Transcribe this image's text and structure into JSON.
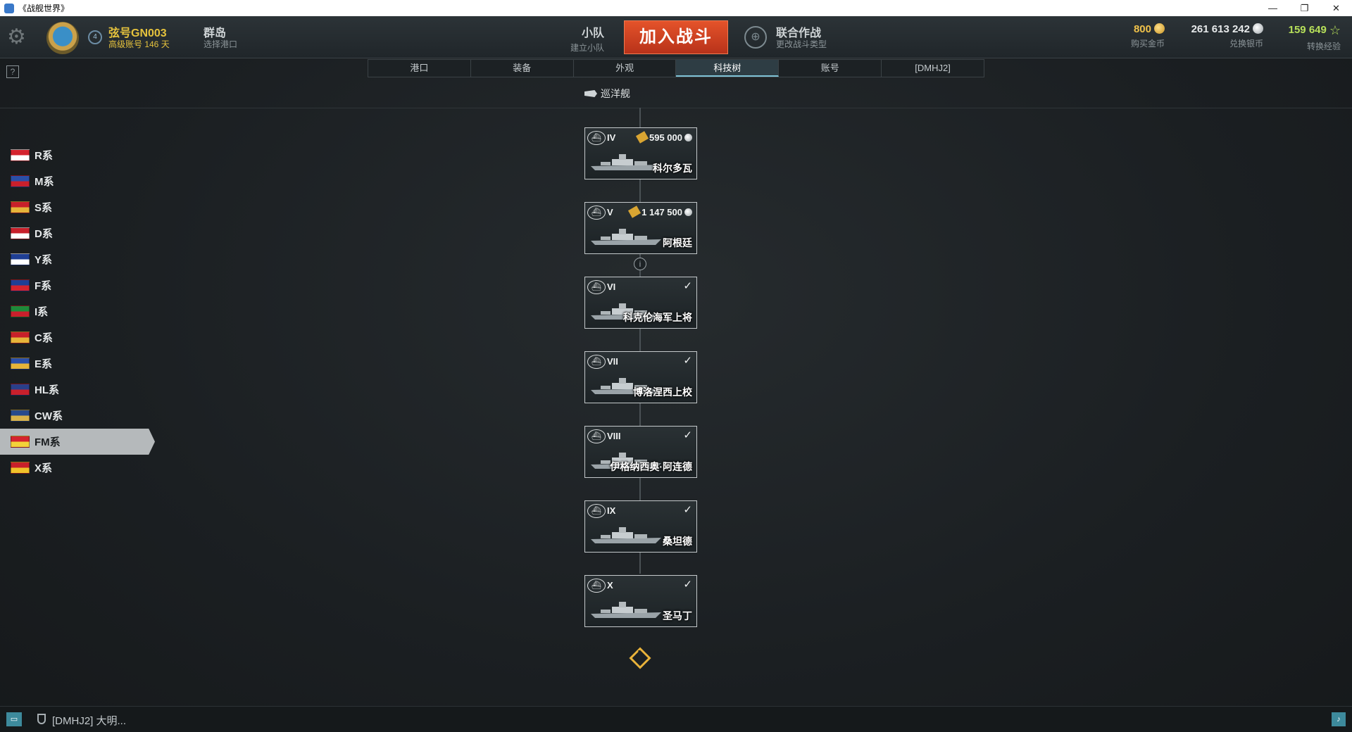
{
  "window": {
    "title": "《战舰世界》",
    "controls": [
      "—",
      "❐",
      "✕"
    ]
  },
  "header": {
    "player_name": "弦号GN003",
    "player_sub": "高级账号 146 天",
    "rank_badge": "4",
    "port_name": "群岛",
    "port_sub": "选择港口",
    "squad_title": "小队",
    "squad_sub": "建立小队",
    "battle_button": "加入战斗",
    "mode_title": "联合作战",
    "mode_sub": "更改战斗类型",
    "gold_value": "800",
    "gold_label": "购买金币",
    "silver_value": "261 613 242",
    "silver_label": "兑换银币",
    "xp_value": "159 649",
    "xp_label": "转换经验"
  },
  "tabs": [
    {
      "label": "港口",
      "active": false
    },
    {
      "label": "装备",
      "active": false
    },
    {
      "label": "外观",
      "active": false
    },
    {
      "label": "科技树",
      "active": true
    },
    {
      "label": "账号",
      "active": false
    },
    {
      "label": "[DMHJ2]",
      "active": false
    }
  ],
  "help_label": "?",
  "ship_class": "巡洋舰",
  "nations": [
    {
      "label": "R系",
      "colors": [
        "#d4232e",
        "#ffffff"
      ]
    },
    {
      "label": "M系",
      "colors": [
        "#2a4fa8",
        "#c9202c"
      ]
    },
    {
      "label": "S系",
      "colors": [
        "#c8202a",
        "#e6b43a"
      ]
    },
    {
      "label": "D系",
      "colors": [
        "#c8202a",
        "#ffffff"
      ]
    },
    {
      "label": "Y系",
      "colors": [
        "#1f3f95",
        "#ffffff"
      ]
    },
    {
      "label": "F系",
      "colors": [
        "#1f3f95",
        "#d4232e"
      ]
    },
    {
      "label": "I系",
      "colors": [
        "#1e8a3a",
        "#c9202c"
      ]
    },
    {
      "label": "C系",
      "colors": [
        "#c8202a",
        "#e6b43a"
      ]
    },
    {
      "label": "E系",
      "colors": [
        "#2a4fa8",
        "#e6b43a"
      ]
    },
    {
      "label": "HL系",
      "colors": [
        "#2a3f8a",
        "#c9202c"
      ]
    },
    {
      "label": "CW系",
      "colors": [
        "#274a8c",
        "#d8b24a"
      ]
    },
    {
      "label": "FM系",
      "colors": [
        "#d4232e",
        "#f3d23a"
      ],
      "active": true
    },
    {
      "label": "X系",
      "colors": [
        "#c8202a",
        "#f0c22a"
      ]
    }
  ],
  "ships": [
    {
      "tier": "IV",
      "name": "科尔多瓦",
      "price": "595 000",
      "researched": false
    },
    {
      "tier": "V",
      "name": "阿根廷",
      "price": "1 147 500",
      "researched": false
    },
    {
      "tier": "VI",
      "name": "科克伦海军上将",
      "price": "",
      "researched": true
    },
    {
      "tier": "VII",
      "name": "博洛涅西上校",
      "price": "",
      "researched": true
    },
    {
      "tier": "VIII",
      "name": "伊格纳西奥·阿连德",
      "price": "",
      "researched": true
    },
    {
      "tier": "IX",
      "name": "桑坦德",
      "price": "",
      "researched": true
    },
    {
      "tier": "X",
      "name": "圣马丁",
      "price": "",
      "researched": true
    }
  ],
  "info_label": "i",
  "bottom": {
    "clan_text": "[DMHJ2] 大明..."
  },
  "colors": {
    "accent": "#d9452a",
    "gold": "#e5c23d",
    "xp": "#b7e05a"
  }
}
